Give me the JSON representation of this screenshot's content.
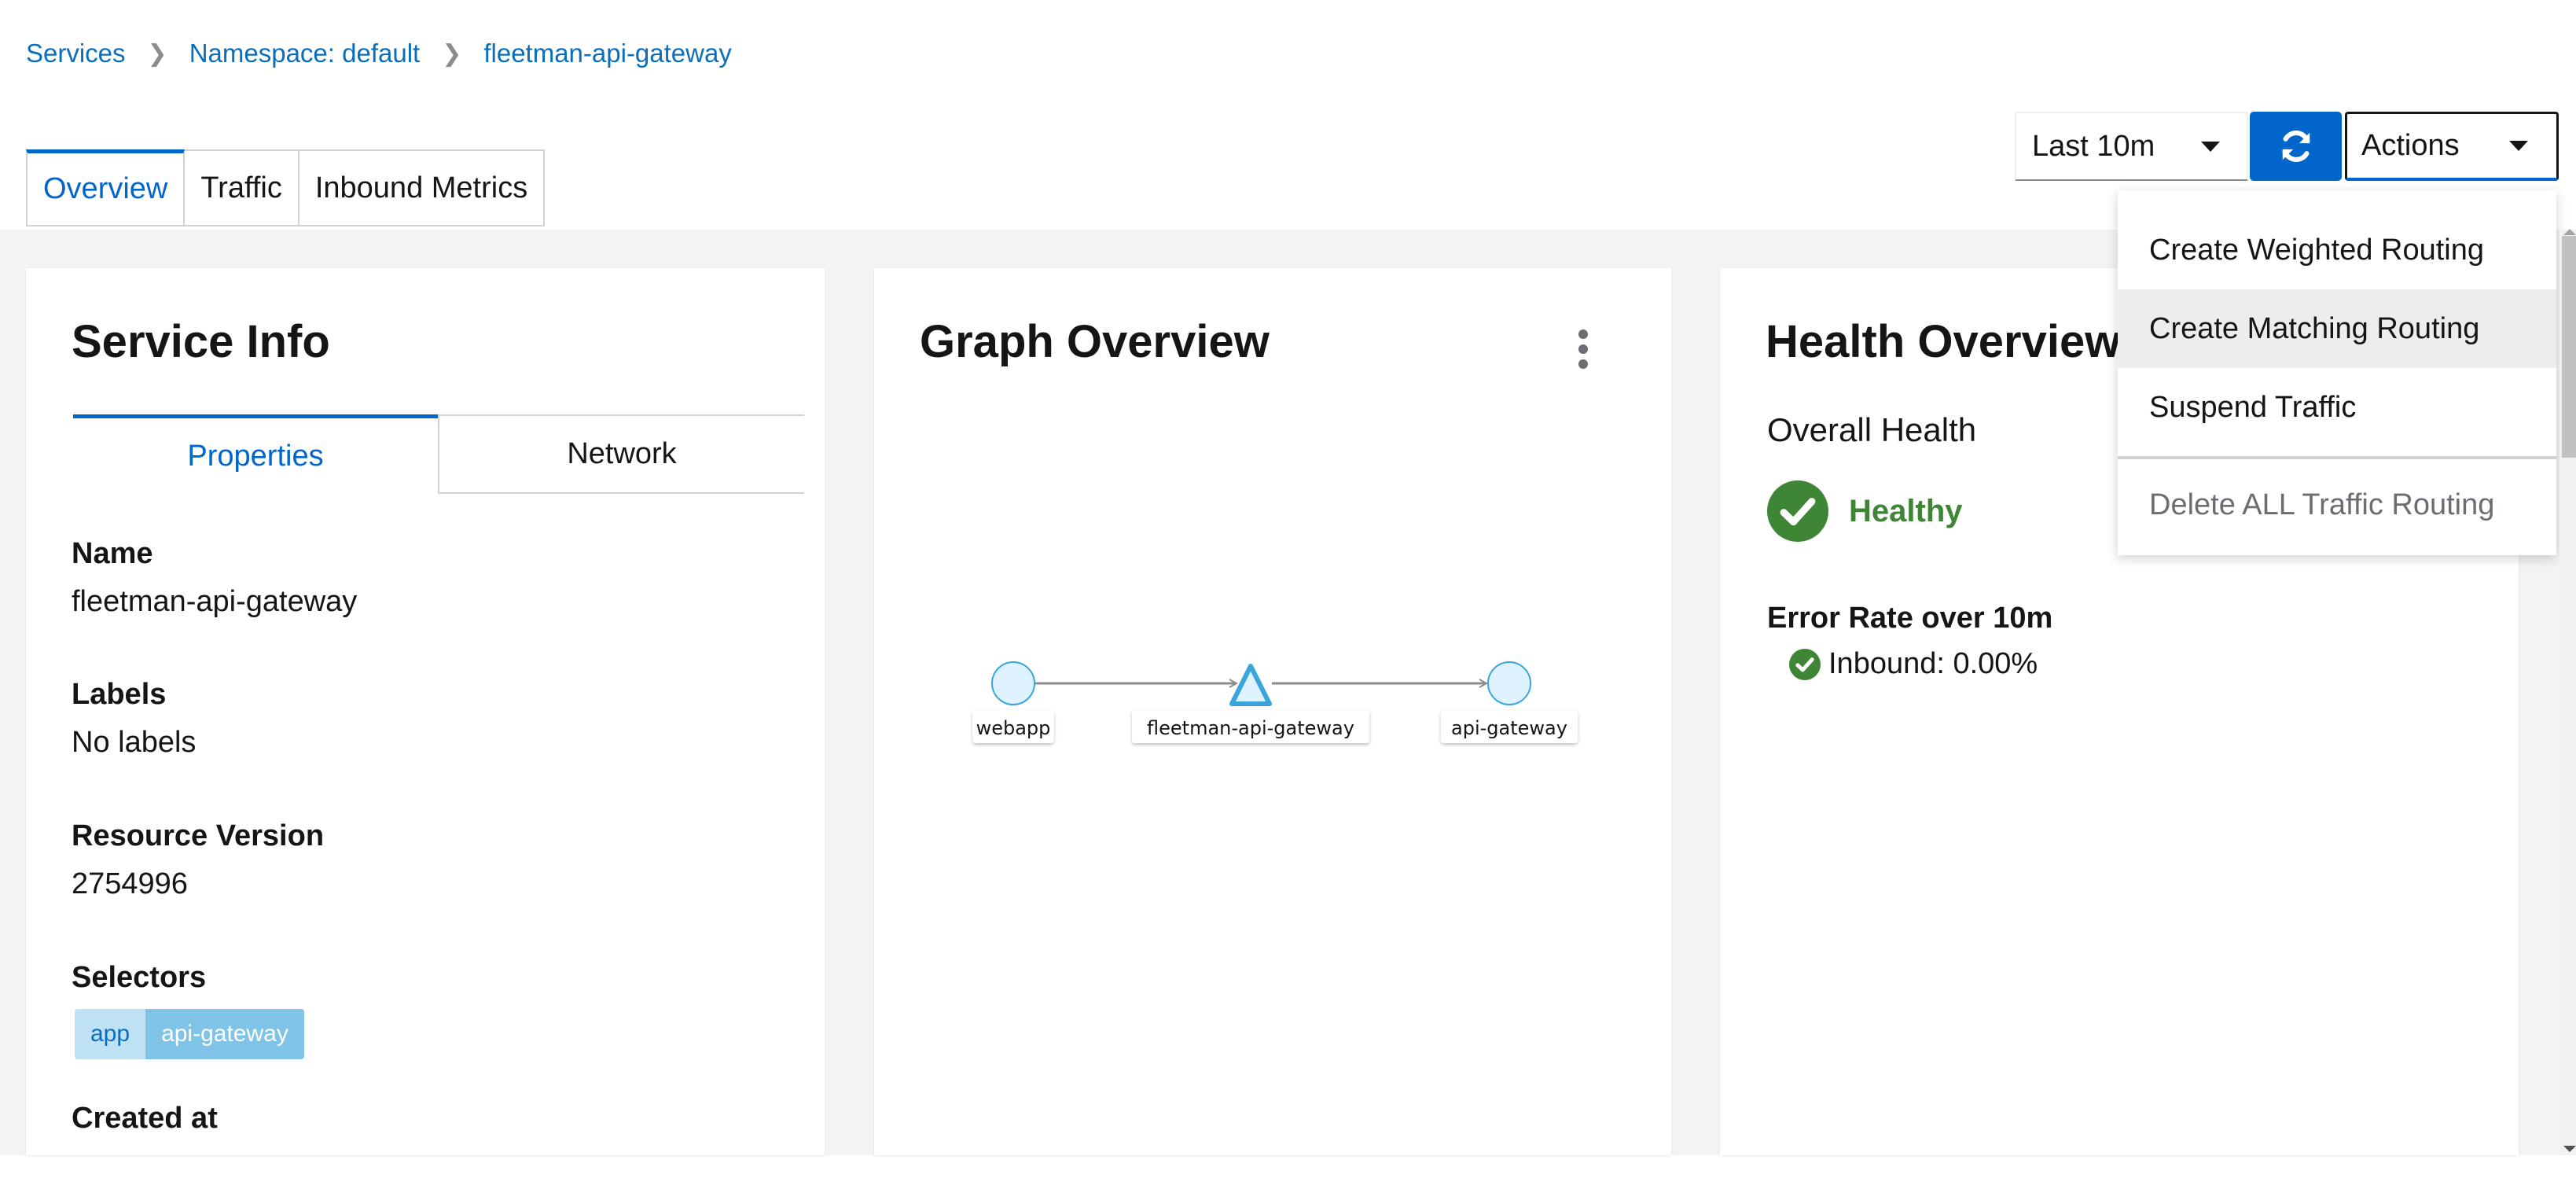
{
  "breadcrumb": [
    {
      "label": "Services"
    },
    {
      "label": "Namespace: default"
    },
    {
      "label": "fleetman-api-gateway"
    }
  ],
  "tabs": [
    {
      "label": "Overview",
      "active": true
    },
    {
      "label": "Traffic",
      "active": false
    },
    {
      "label": "Inbound Metrics",
      "active": false
    }
  ],
  "controls": {
    "time_range": "Last 10m",
    "refresh_icon": "sync-icon",
    "actions_label": "Actions"
  },
  "actions_menu": {
    "items": [
      {
        "label": "Create Weighted Routing",
        "state": "normal"
      },
      {
        "label": "Create Matching Routing",
        "state": "hover"
      },
      {
        "label": "Suspend Traffic",
        "state": "normal"
      },
      {
        "label": "Delete ALL Traffic Routing",
        "state": "disabled"
      }
    ]
  },
  "service_info": {
    "title": "Service Info",
    "subtabs": [
      {
        "label": "Properties",
        "active": true
      },
      {
        "label": "Network",
        "active": false
      }
    ],
    "properties": [
      {
        "label": "Name",
        "value": "fleetman-api-gateway"
      },
      {
        "label": "Labels",
        "value": "No labels"
      },
      {
        "label": "Resource Version",
        "value": "2754996"
      }
    ],
    "selectors_label": "Selectors",
    "selectors": [
      {
        "key": "app",
        "value": "api-gateway"
      }
    ],
    "created_label": "Created at"
  },
  "graph_overview": {
    "title": "Graph Overview",
    "nodes": [
      {
        "id": "webapp",
        "label": "webapp",
        "shape": "circle"
      },
      {
        "id": "fleetman-api-gateway",
        "label": "fleetman-api-gateway",
        "shape": "triangle"
      },
      {
        "id": "api-gateway",
        "label": "api-gateway",
        "shape": "circle"
      }
    ],
    "edges": [
      {
        "from": "webapp",
        "to": "fleetman-api-gateway"
      },
      {
        "from": "fleetman-api-gateway",
        "to": "api-gateway"
      }
    ],
    "colors": {
      "node_fill": "#def3ff",
      "node_stroke": "#39a5dc",
      "edge": "#8a8d90"
    }
  },
  "health_overview": {
    "title": "Health Overview",
    "overall_label": "Overall Health",
    "status": "Healthy",
    "status_color": "#3e8635",
    "error_rate_label": "Error Rate over 10m",
    "inbound": "Inbound: 0.00%"
  }
}
